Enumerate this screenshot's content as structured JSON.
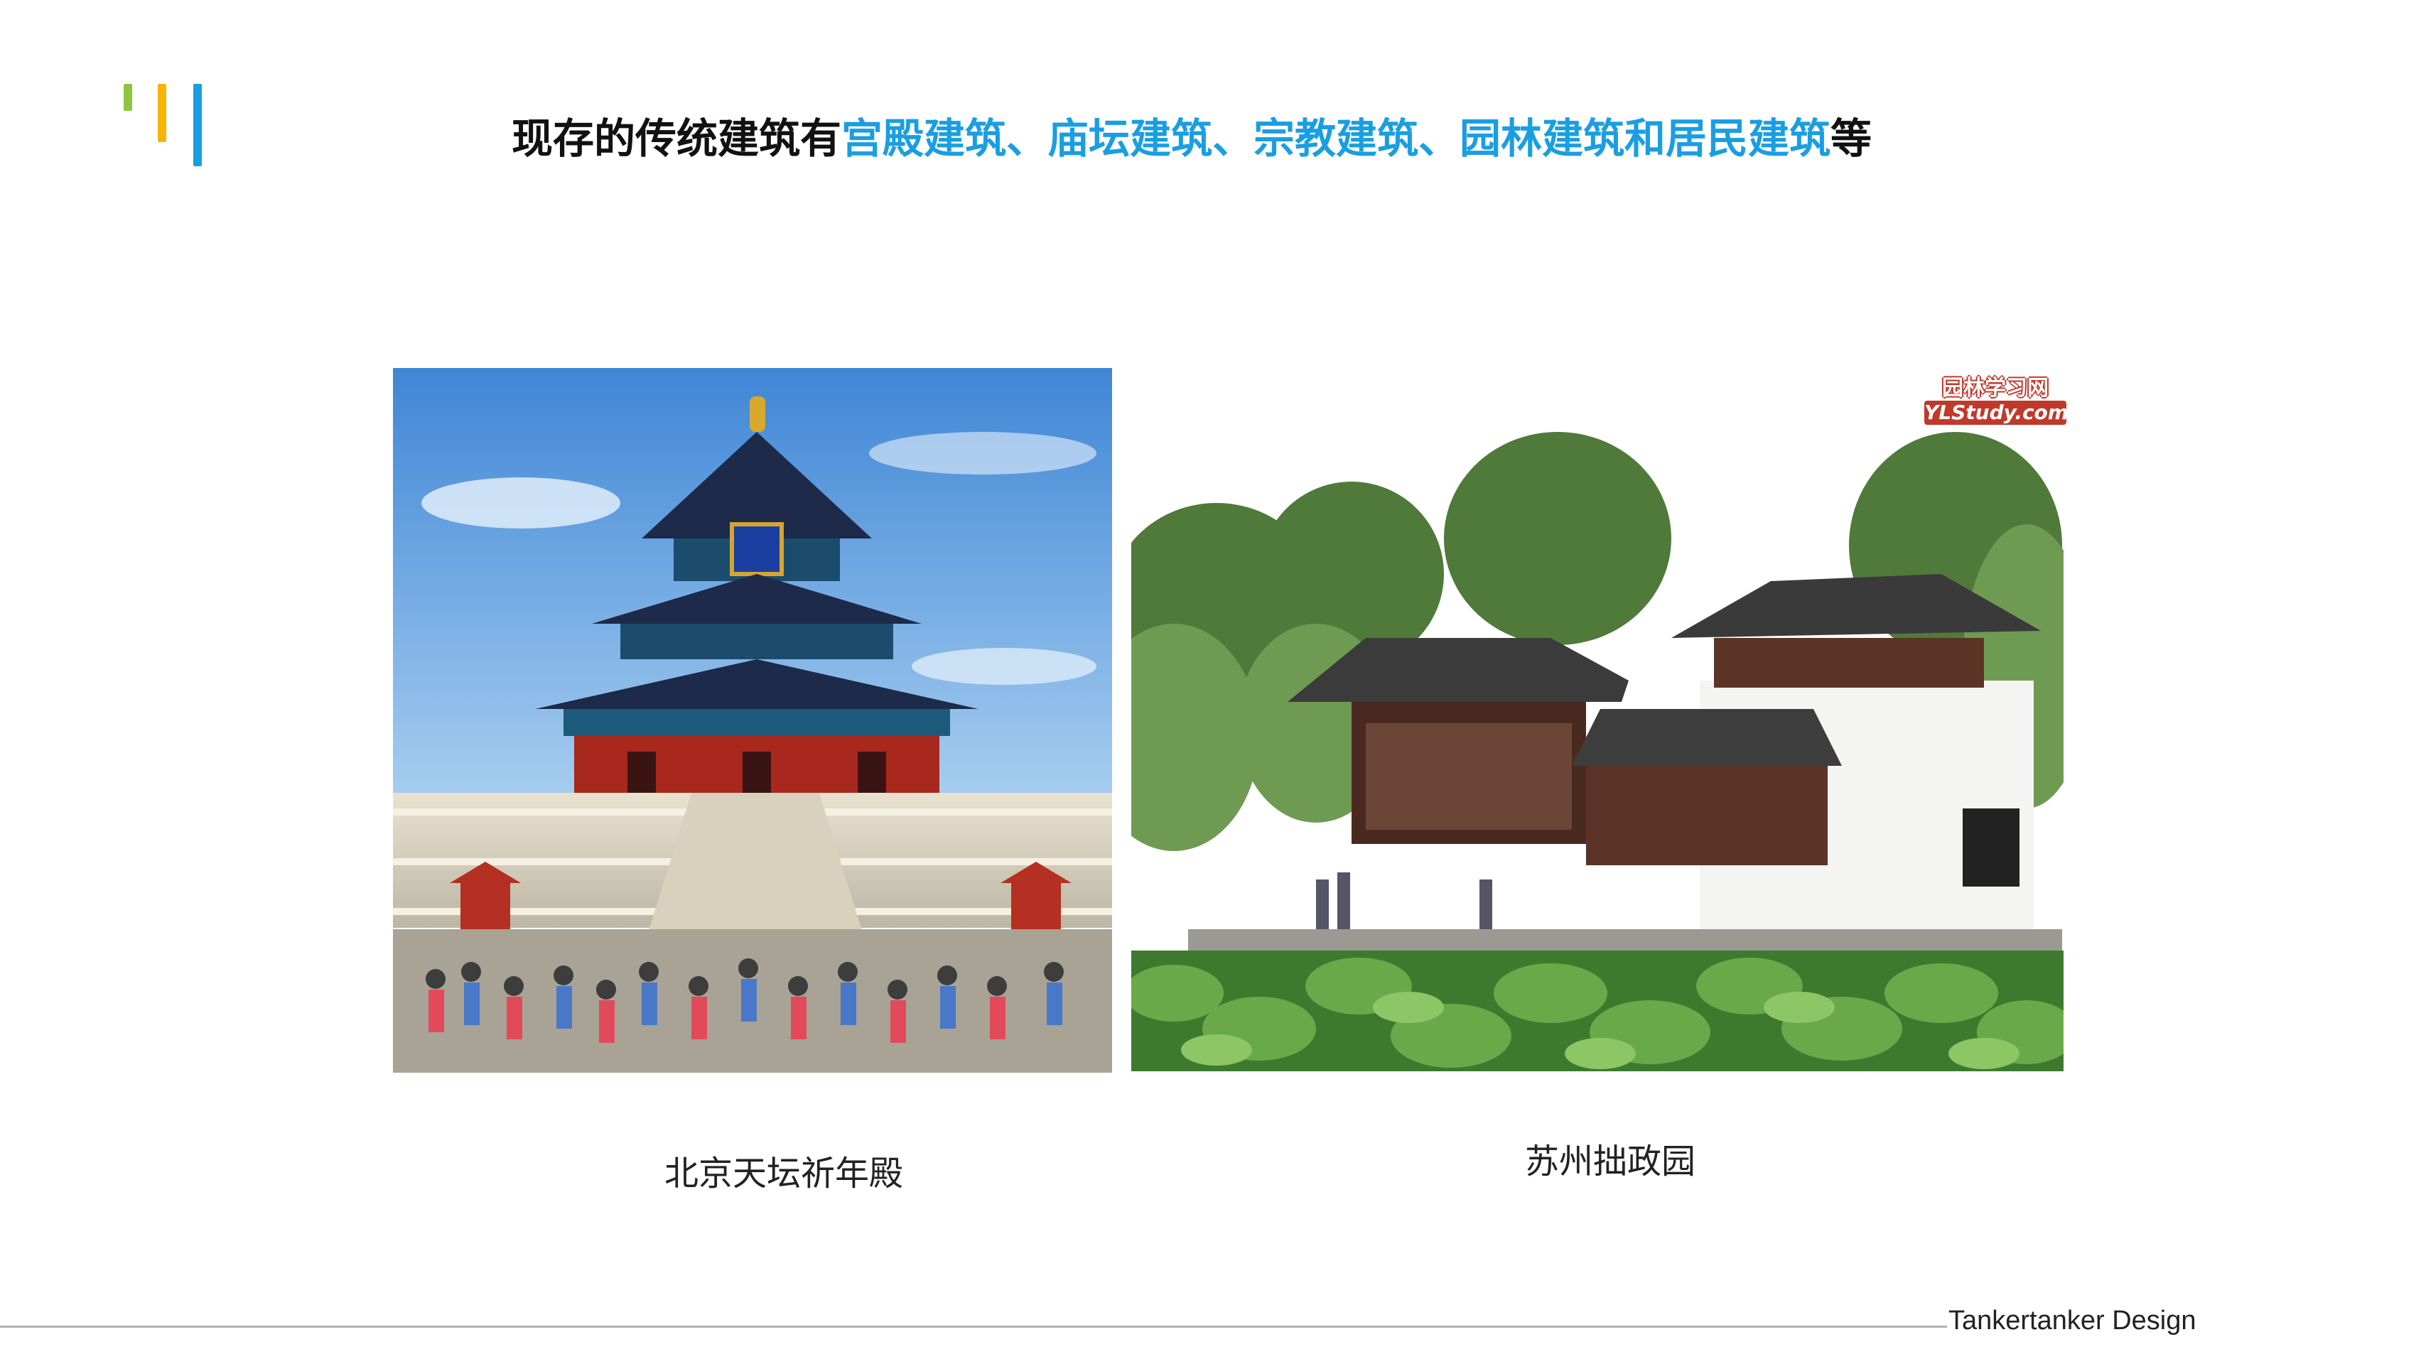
{
  "slide": {
    "title_prefix": "现存的传统建筑有",
    "title_highlight": "宫殿建筑、庙坛建筑、宗教建筑、园林建筑和居民建筑",
    "title_suffix": "等",
    "accent_color": "#1a9ee2",
    "deco_colors": [
      "#8dc63f",
      "#f7b500",
      "#1a9ee2"
    ]
  },
  "photos": [
    {
      "caption": "北京天坛祈年殿",
      "icon": "temple-of-heaven-photo"
    },
    {
      "caption": "苏州拙政园",
      "icon": "humble-administrator-garden-photo",
      "watermark_cn": "园林学习网",
      "watermark_en": "YLStudy.com"
    }
  ],
  "footer": {
    "brand": "Tankertanker Design"
  }
}
